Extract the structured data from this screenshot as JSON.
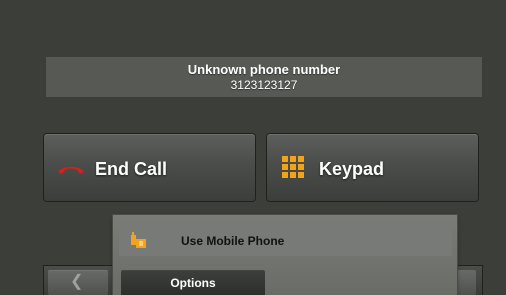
{
  "call": {
    "caller_name": "Unknown phone number",
    "caller_number": "3123123127"
  },
  "actions": {
    "end_call_label": "End Call",
    "keypad_label": "Keypad"
  },
  "popup_menu": {
    "item_label": "Use Mobile Phone"
  },
  "bottom_bar": {
    "options_label": "Options",
    "back_icon": "chevron-left-icon"
  },
  "icons": {
    "end_call": "phone-hangup-icon",
    "keypad": "keypad-grid-icon",
    "mobile_phone": "mobile-phone-icon"
  },
  "colors": {
    "background": "#3b3e39",
    "panel": "#575955",
    "phone_icon": "#d61f1f",
    "keypad_icon": "#f2a31b"
  }
}
